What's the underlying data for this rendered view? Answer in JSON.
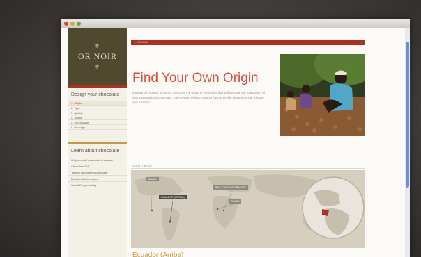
{
  "app": {
    "title": "OR NOIR"
  },
  "sidebar": {
    "logo_ornament": "⚜",
    "logo_text": "OR NOIR",
    "design_heading": "Design your chocolate",
    "steps": [
      "1. Origin",
      "2. Type",
      "3. Quality",
      "4. Shape",
      "5. Personalise",
      "6. Package"
    ],
    "active_step": 0,
    "learn_heading": "Learn about chocolate",
    "learn_links": [
      "Why should I customise chocolate?",
      "Chocolate 101",
      "Tasting and pairing chocolate",
      "Nutritional Information",
      "Social Responsibility"
    ]
  },
  "main": {
    "breadcrumb": "« ORIGIN",
    "headline": "Find Your Own Origin",
    "intro": "Explore the source of cocoa. Discover the origin of the beans that will become the foundation of your personalised chocolate. Each region offers a distinct flavour profile shaped by soil, climate and tradition.",
    "section_label": "SELECT BEAN",
    "country_title": "Ecuador (Arriba)"
  },
  "map": {
    "labels": [
      "BRAZIL",
      "ECUADOR (ARRIBA)",
      "SAO TOME AND PRINCIPE",
      "GHANA"
    ]
  },
  "colors": {
    "accent_red": "#b22e21",
    "headline_red": "#d94f41",
    "sidebar_olive": "#4f4a2f",
    "gold": "#c99b3a"
  }
}
